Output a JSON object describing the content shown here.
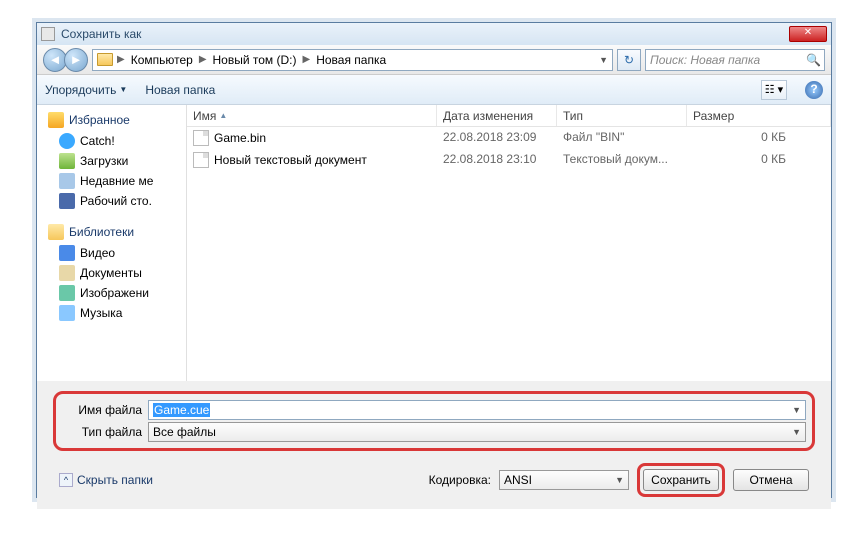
{
  "title": "Сохранить как",
  "breadcrumb": {
    "root": "Компьютер",
    "vol": "Новый том (D:)",
    "folder": "Новая папка"
  },
  "search_placeholder": "Поиск: Новая папка",
  "toolbar": {
    "organize": "Упорядочить",
    "newfolder": "Новая папка"
  },
  "sidebar": {
    "fav_head": "Избранное",
    "fav": [
      "Catch!",
      "Загрузки",
      "Недавние ме",
      "Рабочий сто."
    ],
    "lib_head": "Библиотеки",
    "lib": [
      "Видео",
      "Документы",
      "Изображени",
      "Музыка"
    ]
  },
  "columns": {
    "name": "Имя",
    "date": "Дата изменения",
    "type": "Тип",
    "size": "Размер"
  },
  "files": [
    {
      "name": "Game.bin",
      "date": "22.08.2018 23:09",
      "type": "Файл \"BIN\"",
      "size": "0 КБ"
    },
    {
      "name": "Новый текстовый документ",
      "date": "22.08.2018 23:10",
      "type": "Текстовый докум...",
      "size": "0 КБ"
    }
  ],
  "labels": {
    "filename": "Имя файла",
    "filetype": "Тип файла",
    "encoding": "Кодировка:",
    "hide": "Скрыть папки"
  },
  "values": {
    "filename": "Game.cue",
    "filetype": "Все файлы",
    "encoding": "ANSI"
  },
  "buttons": {
    "save": "Сохранить",
    "cancel": "Отмена"
  }
}
